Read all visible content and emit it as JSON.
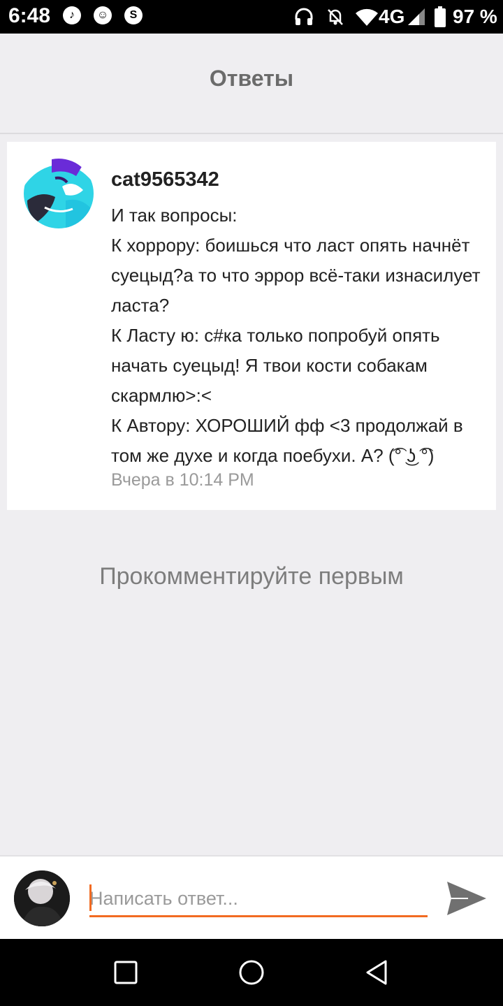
{
  "status_bar": {
    "time": "6:48",
    "network": "4G",
    "battery": "97 %",
    "icons": [
      "music-icon",
      "lion-app-icon",
      "shazam-icon",
      "headphones-icon",
      "notifications-off-icon",
      "wifi-icon",
      "signal-icon",
      "battery-icon"
    ]
  },
  "header": {
    "title": "Ответы"
  },
  "comment": {
    "username": "cat9565342",
    "text": "И так вопросы:\nК хоррору: боишься что ласт опять начнёт суецыд?а то что эррор всё-таки изнасилует ласта?\nК Ласту ю: с#ка только попробуй опять начать суецыд! Я твои кости собакам скармлю>:<\nК Автору: ХОРОШИЙ фф <3 продолжай в том же духе и  когда поебухи. А? (͡° ͜ʖ ͡°)",
    "timestamp": "Вчера в 10:14 PM"
  },
  "empty_state": "Прокомментируйте первым",
  "reply": {
    "placeholder": "Написать ответ...",
    "value": ""
  },
  "colors": {
    "accent": "#f26a21",
    "background": "#efeef1",
    "card": "#ffffff"
  }
}
